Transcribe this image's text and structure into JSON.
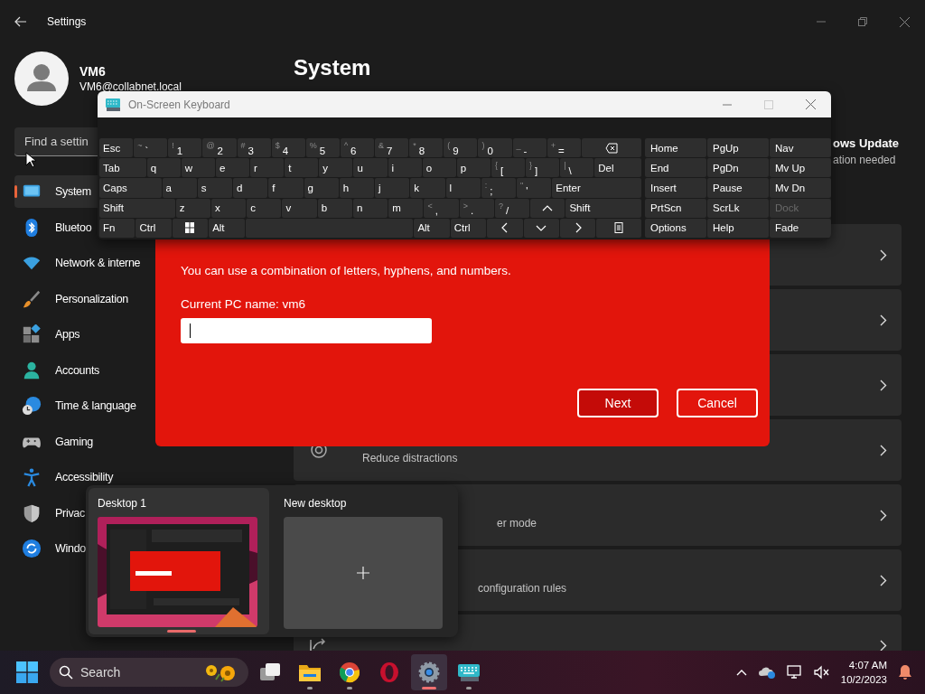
{
  "settings_window": {
    "title": "Settings",
    "user": {
      "name": "VM6",
      "email": "VM6@collabnet.local"
    },
    "search": {
      "placeholder": "Find a settin"
    },
    "nav": [
      {
        "label": "System",
        "selected": true
      },
      {
        "label": "Bluetoo",
        "selected": false
      },
      {
        "label": "Network & interne",
        "selected": false
      },
      {
        "label": "Personalization",
        "selected": false
      },
      {
        "label": "Apps",
        "selected": false
      },
      {
        "label": "Accounts",
        "selected": false
      },
      {
        "label": "Time & language",
        "selected": false
      },
      {
        "label": "Gaming",
        "selected": false
      },
      {
        "label": "Accessibility",
        "selected": false
      },
      {
        "label": "Privac",
        "selected": false
      },
      {
        "label": "Windo",
        "selected": false
      }
    ],
    "page_title": "System",
    "update_status": {
      "title": "ows Update",
      "subtitle": "ation needed"
    },
    "cards": [
      {
        "kind": "plain"
      },
      {
        "kind": "plain"
      },
      {
        "kind": "plain"
      },
      {
        "kind": "focus",
        "subtitle": "Reduce distractions"
      },
      {
        "kind": "plain",
        "subtitle": "er mode"
      },
      {
        "kind": "plain",
        "subtitle": "configuration rules"
      },
      {
        "kind": "share"
      }
    ]
  },
  "dialog": {
    "description": "You can use a combination of letters, hyphens, and numbers.",
    "current_name": "Current PC name: vm6",
    "buttons": [
      {
        "label": "Next",
        "kind": "primary"
      },
      {
        "label": "Cancel",
        "kind": "secondary"
      }
    ]
  },
  "keyboard": {
    "title": "On-Screen Keyboard",
    "rows": [
      [
        {
          "kind": "label",
          "label": "Esc"
        },
        {
          "kind": "char",
          "shift": "~",
          "main": "`"
        },
        {
          "kind": "char",
          "shift": "!",
          "main": "1"
        },
        {
          "kind": "char",
          "shift": "@",
          "main": "2"
        },
        {
          "kind": "char",
          "shift": "#",
          "main": "3"
        },
        {
          "kind": "char",
          "shift": "$",
          "main": "4"
        },
        {
          "kind": "char",
          "shift": "%",
          "main": "5"
        },
        {
          "kind": "char",
          "shift": "^",
          "main": "6"
        },
        {
          "kind": "char",
          "shift": "&",
          "main": "7"
        },
        {
          "kind": "char",
          "shift": "*",
          "main": "8"
        },
        {
          "kind": "char",
          "shift": "(",
          "main": "9"
        },
        {
          "kind": "char",
          "shift": ")",
          "main": "0"
        },
        {
          "kind": "char",
          "shift": "_",
          "main": "-"
        },
        {
          "kind": "char",
          "shift": "+",
          "main": "="
        },
        {
          "kind": "backspace"
        }
      ],
      [
        {
          "kind": "label",
          "label": "Tab"
        },
        {
          "kind": "label",
          "label": "q"
        },
        {
          "kind": "label",
          "label": "w"
        },
        {
          "kind": "label",
          "label": "e"
        },
        {
          "kind": "label",
          "label": "r"
        },
        {
          "kind": "label",
          "label": "t"
        },
        {
          "kind": "label",
          "label": "y"
        },
        {
          "kind": "label",
          "label": "u"
        },
        {
          "kind": "label",
          "label": "i"
        },
        {
          "kind": "label",
          "label": "o"
        },
        {
          "kind": "label",
          "label": "p"
        },
        {
          "kind": "char",
          "shift": "{",
          "main": "["
        },
        {
          "kind": "char",
          "shift": "}",
          "main": "]"
        },
        {
          "kind": "char",
          "shift": "|",
          "main": "\\"
        },
        {
          "kind": "label",
          "label": "Del"
        }
      ],
      [
        {
          "kind": "label",
          "label": "Caps"
        },
        {
          "kind": "label",
          "label": "a"
        },
        {
          "kind": "label",
          "label": "s"
        },
        {
          "kind": "label",
          "label": "d"
        },
        {
          "kind": "label",
          "label": "f"
        },
        {
          "kind": "label",
          "label": "g"
        },
        {
          "kind": "label",
          "label": "h"
        },
        {
          "kind": "label",
          "label": "j"
        },
        {
          "kind": "label",
          "label": "k"
        },
        {
          "kind": "label",
          "label": "l"
        },
        {
          "kind": "char",
          "shift": ":",
          "main": ";"
        },
        {
          "kind": "char",
          "shift": "\"",
          "main": "'"
        },
        {
          "kind": "label",
          "label": "Enter"
        }
      ],
      [
        {
          "kind": "label",
          "label": "Shift"
        },
        {
          "kind": "label",
          "label": "z"
        },
        {
          "kind": "label",
          "label": "x"
        },
        {
          "kind": "label",
          "label": "c"
        },
        {
          "kind": "label",
          "label": "v"
        },
        {
          "kind": "label",
          "label": "b"
        },
        {
          "kind": "label",
          "label": "n"
        },
        {
          "kind": "label",
          "label": "m"
        },
        {
          "kind": "char",
          "shift": "<",
          "main": ","
        },
        {
          "kind": "char",
          "shift": ">",
          "main": "."
        },
        {
          "kind": "char",
          "shift": "?",
          "main": "/"
        },
        {
          "kind": "up"
        },
        {
          "kind": "label",
          "label": "Shift"
        }
      ],
      [
        {
          "kind": "label",
          "label": "Fn"
        },
        {
          "kind": "label",
          "label": "Ctrl"
        },
        {
          "kind": "windows"
        },
        {
          "kind": "label",
          "label": "Alt"
        },
        {
          "kind": "space"
        },
        {
          "kind": "label",
          "label": "Alt"
        },
        {
          "kind": "label",
          "label": "Ctrl"
        },
        {
          "kind": "left"
        },
        {
          "kind": "down"
        },
        {
          "kind": "right"
        },
        {
          "kind": "menu"
        }
      ]
    ],
    "nav_keys": [
      {
        "label": "Home",
        "disabled": false
      },
      {
        "label": "PgUp",
        "disabled": false
      },
      {
        "label": "Nav",
        "disabled": false
      },
      {
        "label": "End",
        "disabled": false
      },
      {
        "label": "PgDn",
        "disabled": false
      },
      {
        "label": "Mv Up",
        "disabled": false
      },
      {
        "label": "Insert",
        "disabled": false
      },
      {
        "label": "Pause",
        "disabled": false
      },
      {
        "label": "Mv Dn",
        "disabled": false
      },
      {
        "label": "PrtScn",
        "disabled": false
      },
      {
        "label": "ScrLk",
        "disabled": false
      },
      {
        "label": "Dock",
        "disabled": true
      },
      {
        "label": "Options",
        "disabled": false
      },
      {
        "label": "Help",
        "disabled": false
      },
      {
        "label": "Fade",
        "disabled": false
      }
    ]
  },
  "task_view": {
    "desktops": [
      {
        "label": "Desktop 1",
        "selected": true,
        "kind": "picture"
      },
      {
        "label": "New desktop",
        "selected": false,
        "kind": "new"
      }
    ]
  },
  "taskbar": {
    "search": {
      "placeholder": "Search"
    },
    "apps": [
      {
        "kind": "task-view",
        "running": false,
        "active": false
      },
      {
        "kind": "folder",
        "running": true,
        "active": false
      },
      {
        "kind": "browser",
        "running": true,
        "active": false
      },
      {
        "kind": "ring-browser",
        "running": false,
        "active": false
      },
      {
        "kind": "settings",
        "running": true,
        "active": true
      },
      {
        "kind": "keyboard",
        "running": true,
        "active": false
      }
    ],
    "time": "4:07 AM",
    "date": "10/2/2023"
  }
}
